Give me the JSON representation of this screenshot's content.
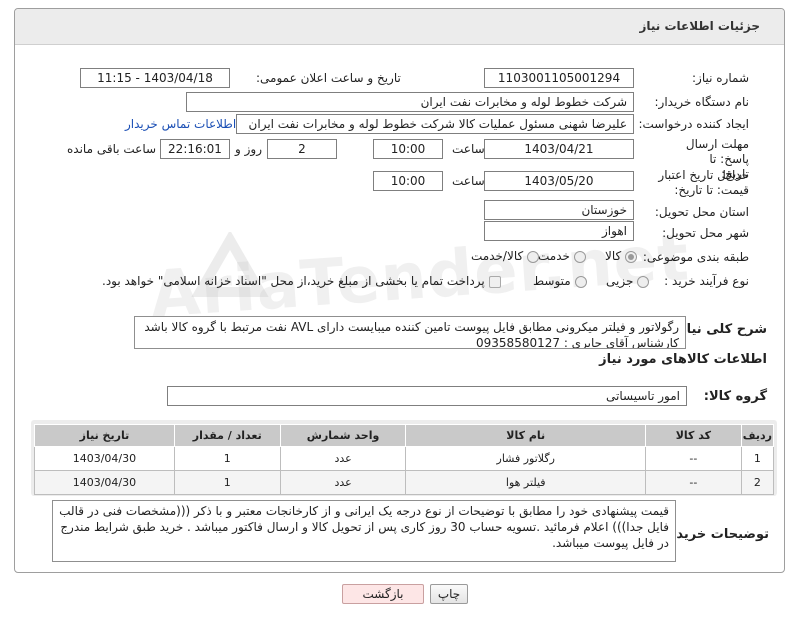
{
  "panel": {
    "title": "جزئیات اطلاعات نیاز"
  },
  "fields": {
    "need_number_label": "شماره نیاز:",
    "need_number": "1103001105001294",
    "announce_label": "تاریخ و ساعت اعلان عمومی:",
    "announce_value": "1403/04/18 - 11:15",
    "buyer_label": "نام دستگاه خریدار:",
    "buyer_value": "شرکت خطوط لوله و مخابرات نفت ایران",
    "creator_label": "ایجاد کننده درخواست:",
    "creator_value": "علیرضا شهنی مسئول عملیات کالا شرکت خطوط لوله و مخابرات نفت ایران",
    "contact_link": "اطلاعات تماس خریدار",
    "deadline_label": "مهلت ارسال پاسخ: تا تاریخ:",
    "deadline_date": "1403/04/21",
    "time_label": "ساعت",
    "deadline_time": "10:00",
    "days_value": "2",
    "days_label": "روز و",
    "remaining_time": "22:16:01",
    "remaining_label": "ساعت باقی مانده",
    "validity_label": "حداقل تاریخ اعتبار قیمت: تا تاریخ:",
    "validity_date": "1403/05/20",
    "validity_time": "10:00",
    "province_label": "استان محل تحویل:",
    "province_value": "خوزستان",
    "city_label": "شهر محل تحویل:",
    "city_value": "اهواز",
    "category_label": "طبقه بندی موضوعی:",
    "category_options": [
      "کالا",
      "خدمت",
      "کالا/خدمت"
    ],
    "process_label": "نوع فرآیند خرید :",
    "process_options": [
      "جزیی",
      "متوسط"
    ],
    "payment_text": "پرداخت تمام یا بخشی از مبلغ خرید،از محل \"اسناد خزانه اسلامی\" خواهد بود.",
    "summary_label": "شرح کلی نیاز:",
    "summary_line1": "رگولاتور و فیلتر میکرونی مطابق فایل پیوست تامین کننده میبایست دارای AVL نفت مرتبط با گروه کالا باشد",
    "summary_line2": "کارشناس آقای جابری : 09358580127"
  },
  "goods": {
    "section_title": "اطلاعات کالاهای مورد نیاز",
    "group_label": "گروه کالا:",
    "group_value": "امور تاسیساتی",
    "columns": [
      "ردیف",
      "کد کالا",
      "نام کالا",
      "واحد شمارش",
      "تعداد / مقدار",
      "تاریخ نیاز"
    ],
    "rows": [
      [
        "1",
        "--",
        "رگلاتور فشار",
        "عدد",
        "1",
        "1403/04/30"
      ],
      [
        "2",
        "--",
        "فیلتر هوا",
        "عدد",
        "1",
        "1403/04/30"
      ]
    ]
  },
  "buyer_notes": {
    "label": "توضیحات خریدار:",
    "text": "قیمت پیشنهادی خود را مطابق با توضیحات از نوع درجه یک ایرانی و از کارخانجات معتبر و با ذکر (((مشخصات فنی در قالب فایل جدا))) اعلام فرمائید .تسویه حساب  30 روز کاری پس از تحویل کالا و ارسال فاکتور میباشد . خرید طبق شرایط مندرج در فایل پیوست میباشد."
  },
  "buttons": {
    "print": "چاپ",
    "back": "بازگشت"
  },
  "watermark": "AriaTender.net"
}
